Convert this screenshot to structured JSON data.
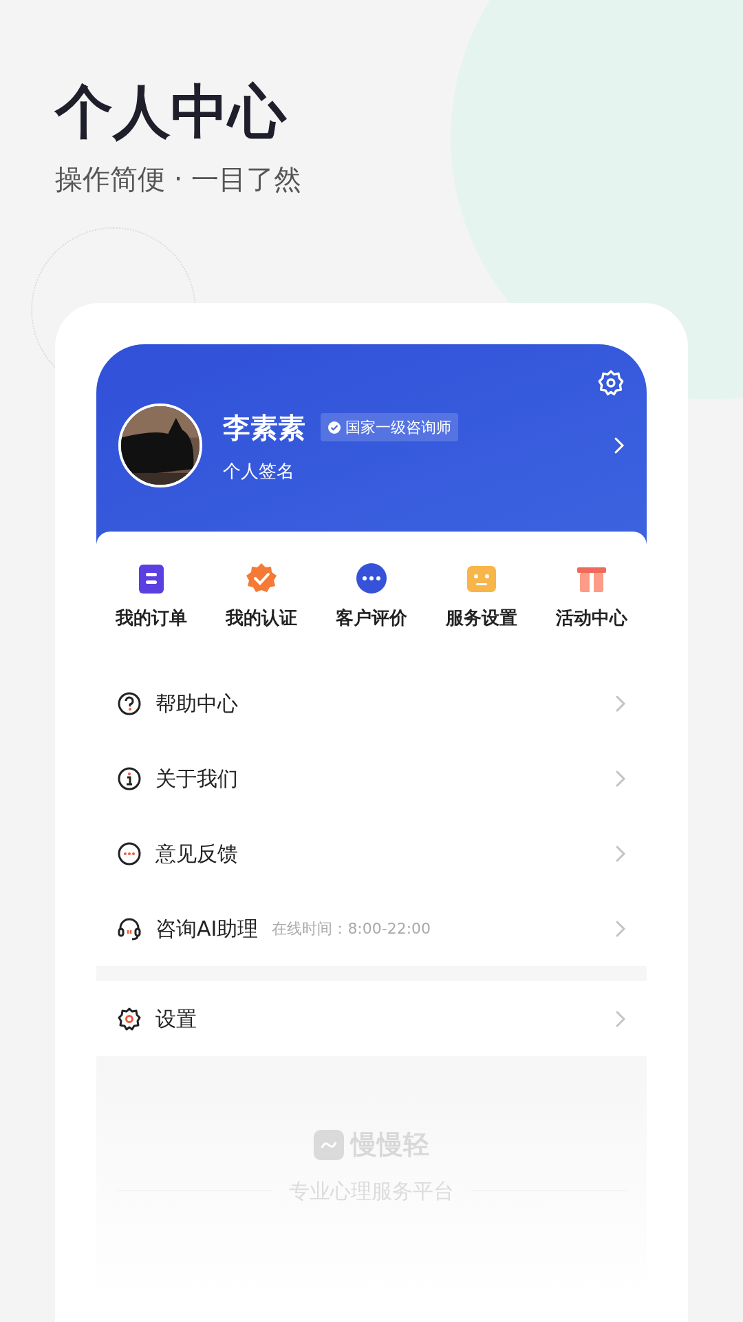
{
  "headline": {
    "title": "个人中心",
    "subtitle": "操作简便 · 一目了然"
  },
  "profile": {
    "name": "李素素",
    "badge": "国家一级咨询师",
    "signature": "个人签名"
  },
  "shortcuts": [
    {
      "label": "我的订单",
      "kind": "order"
    },
    {
      "label": "我的认证",
      "kind": "cert"
    },
    {
      "label": "客户评价",
      "kind": "review"
    },
    {
      "label": "服务设置",
      "kind": "service"
    },
    {
      "label": "活动中心",
      "kind": "gift"
    }
  ],
  "menu": [
    {
      "label": "帮助中心",
      "kind": "help"
    },
    {
      "label": "关于我们",
      "kind": "info"
    },
    {
      "label": "意见反馈",
      "kind": "feedback"
    },
    {
      "label": "咨询AI助理",
      "kind": "assistant",
      "note": "在线时间：8:00-22:00"
    }
  ],
  "settings_menu": [
    {
      "label": "设置",
      "kind": "settings"
    }
  ],
  "footer": {
    "brand": "慢慢轻",
    "tagline": "专业心理服务平台"
  }
}
